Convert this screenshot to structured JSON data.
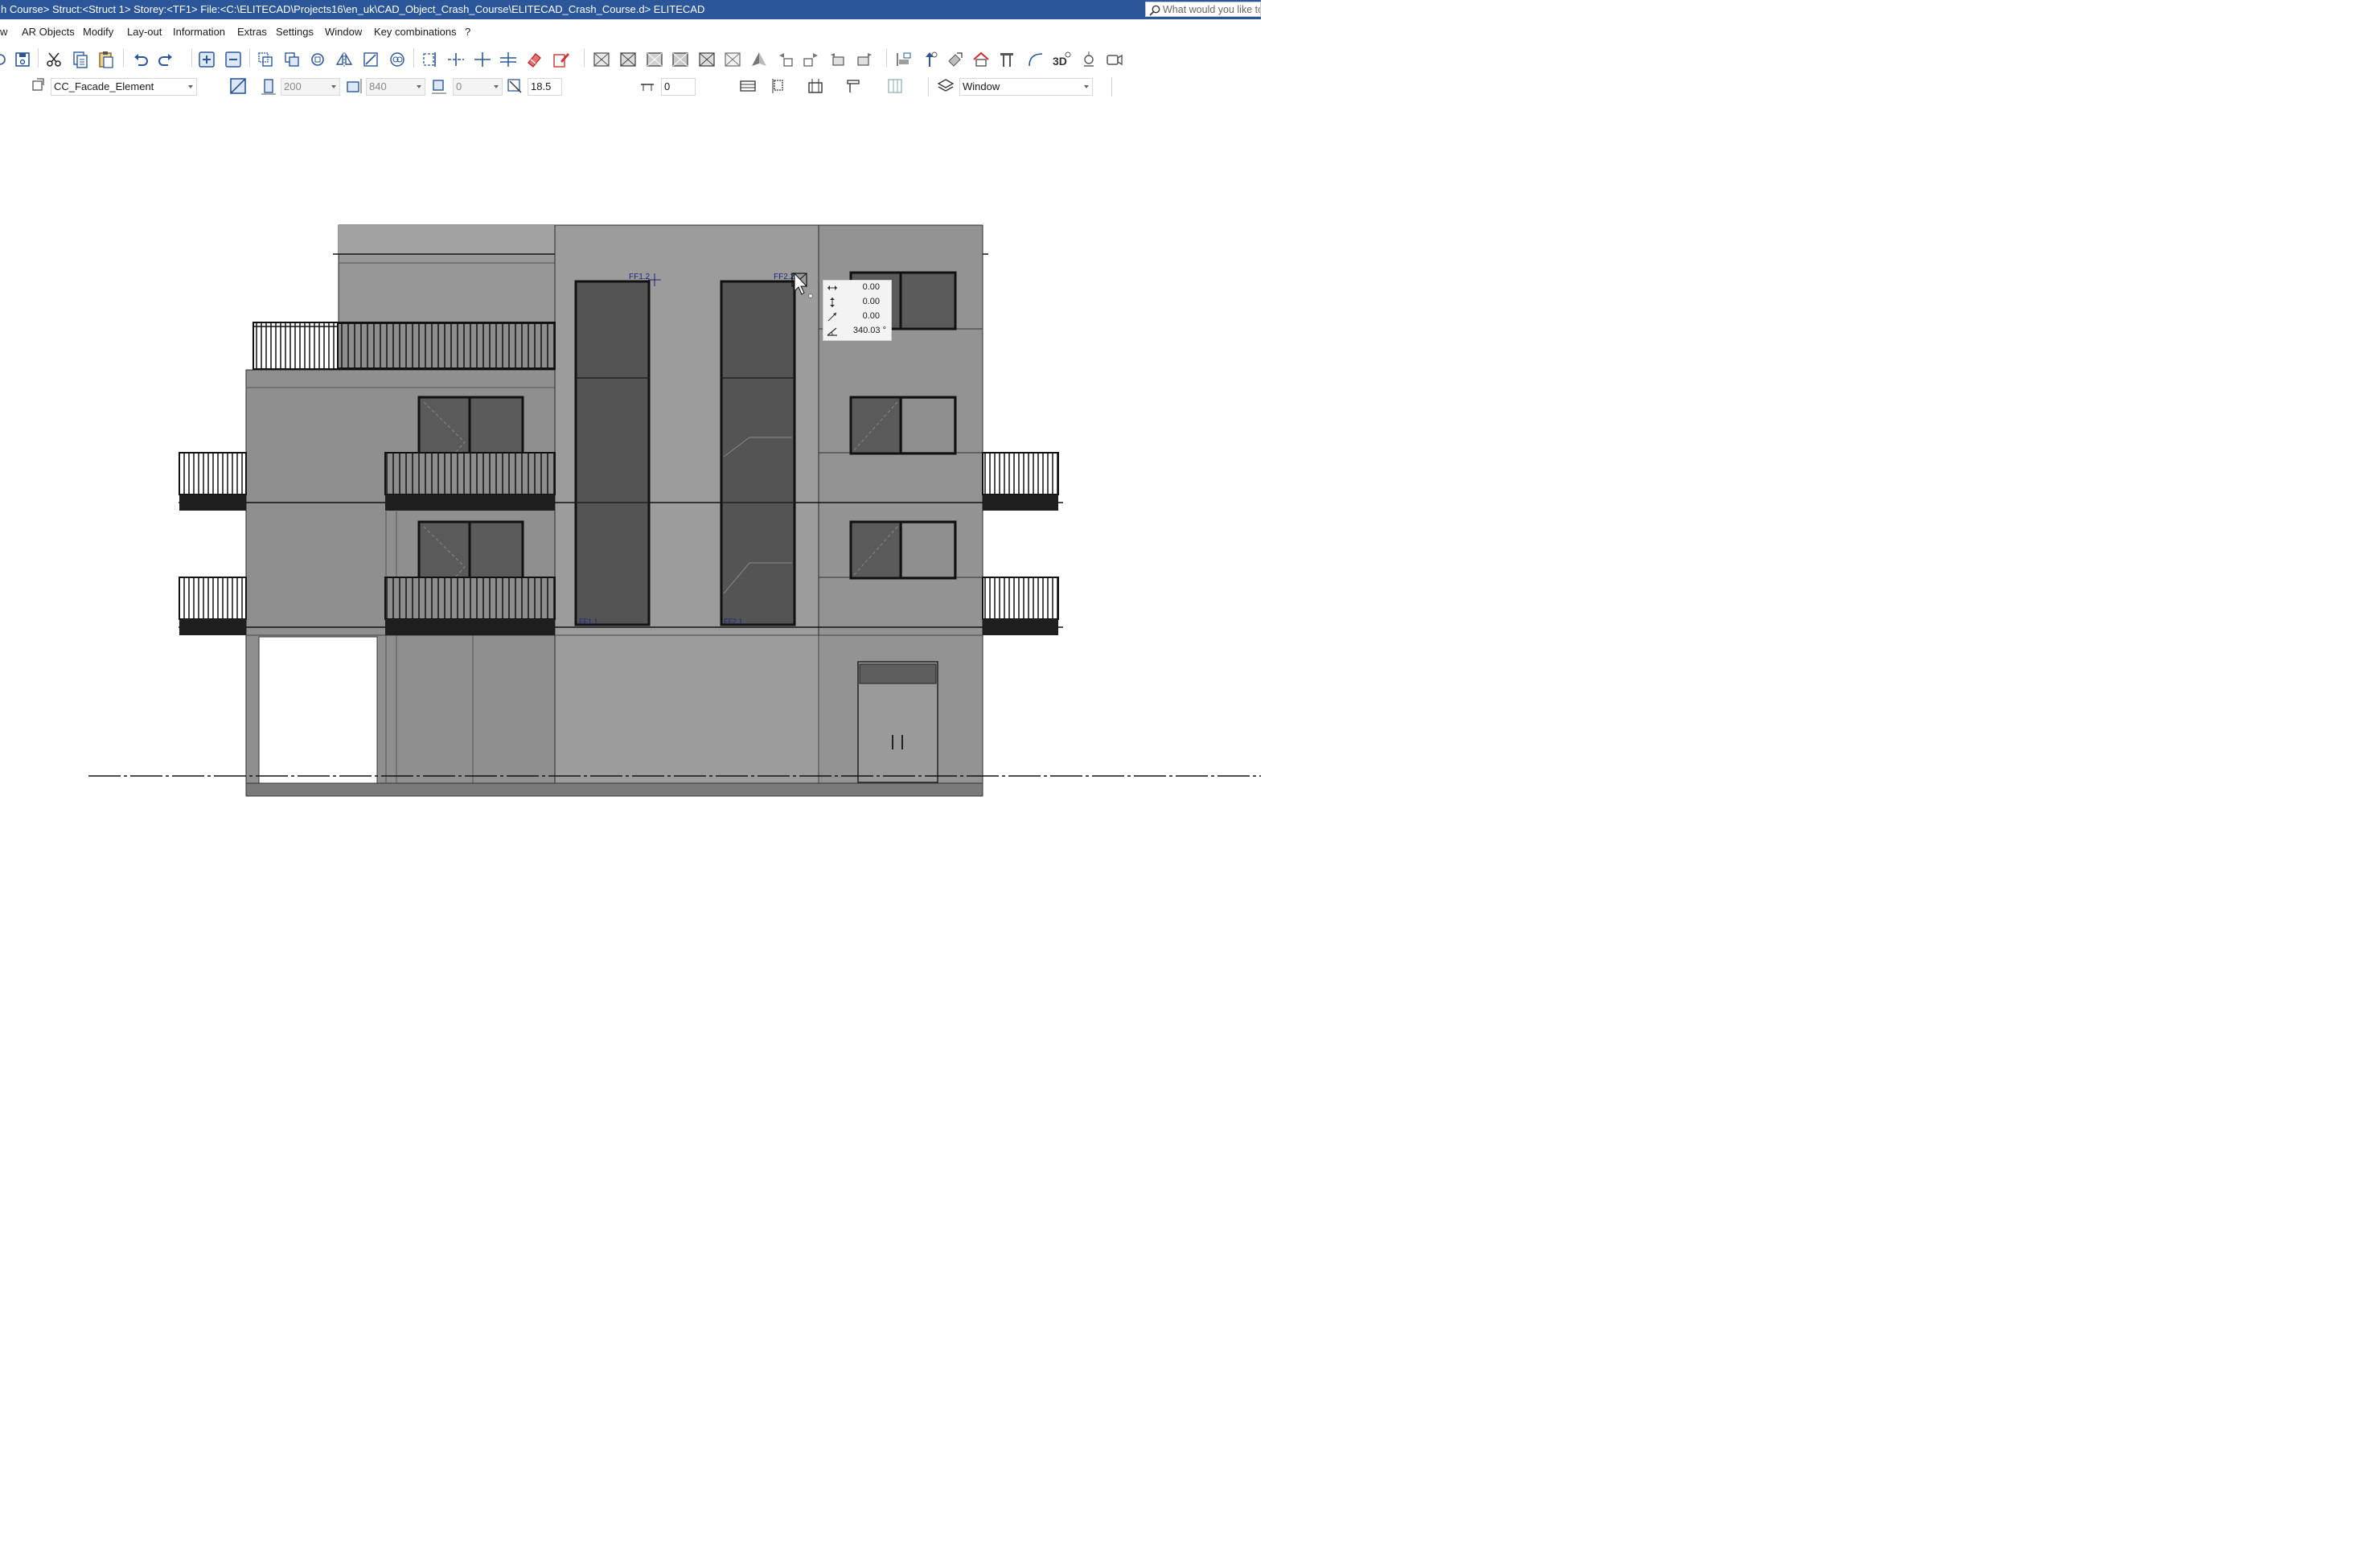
{
  "title_bar": {
    "text": "h Course> Struct:<Struct 1>  Storey:<TF1>  File:<C:\\ELITECAD\\Projects16\\en_uk\\CAD_Object_Crash_Course\\ELITECAD_Crash_Course.d> ELITECAD",
    "search_placeholder": "What would you like to"
  },
  "menu": {
    "items": [
      "w",
      "AR Objects",
      "Modify",
      "Lay-out",
      "Information",
      "Extras",
      "Settings",
      "Window",
      "Key combinations",
      "?"
    ]
  },
  "props_bar": {
    "element_type": "CC_Facade_Element",
    "width": "200",
    "length": "840",
    "offset": "0",
    "angle": "18.5",
    "sill_height": "0",
    "layer": "Window"
  },
  "drawing": {
    "labels": [
      "FF1.2",
      "FF2.2"
    ],
    "floor_tags": [
      "FF1.1",
      "FF2.1"
    ]
  },
  "coord_tooltip": {
    "dx": "0.00",
    "dy": "0.00",
    "dist": "0.00",
    "angle": "340.03 °"
  },
  "colors": {
    "title_bar": "#2b579a",
    "facade": "#8d8d8d",
    "facade_light": "#9a9a9a",
    "window_glass": "#555555",
    "cad_label": "#1a237e"
  },
  "icons": [
    "new-icon",
    "save-icon",
    "cut-icon",
    "copy-icon",
    "paste-icon",
    "undo-icon",
    "redo-icon",
    "zoom-in-icon",
    "zoom-out-icon",
    "eraser-icon",
    "3d-view-icon",
    "camera-icon",
    "light-icon",
    "layer-icon",
    "search-icon"
  ]
}
